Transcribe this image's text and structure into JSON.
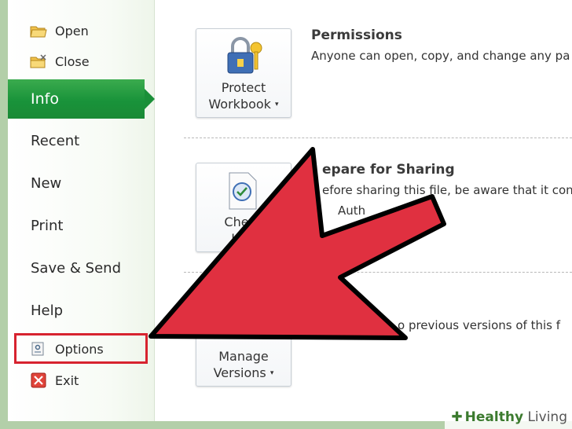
{
  "sidebar": {
    "open_label": "Open",
    "close_label": "Close",
    "info_label": "Info",
    "recent_label": "Recent",
    "new_label": "New",
    "print_label": "Print",
    "save_send_label": "Save & Send",
    "help_label": "Help",
    "options_label": "Options",
    "exit_label": "Exit"
  },
  "main": {
    "permissions": {
      "button_line1": "Protect",
      "button_line2": "Workbook",
      "heading": "Permissions",
      "description": "Anyone can open, copy, and change any pa"
    },
    "sharing": {
      "button_line1": "Check",
      "button_line2": "Issu",
      "heading": "epare for Sharing",
      "description": "efore sharing this file, be aware that it con",
      "sub_item": "Auth"
    },
    "versions": {
      "button_line1": "Manage",
      "button_line2": "Versions",
      "description": "o previous versions of this f"
    }
  },
  "watermark": {
    "brand": "Healthy",
    "brand2": "Living"
  },
  "colors": {
    "info_tab": "#1a8f38",
    "highlight_box": "#d7232f",
    "arrow": "#e03040"
  }
}
